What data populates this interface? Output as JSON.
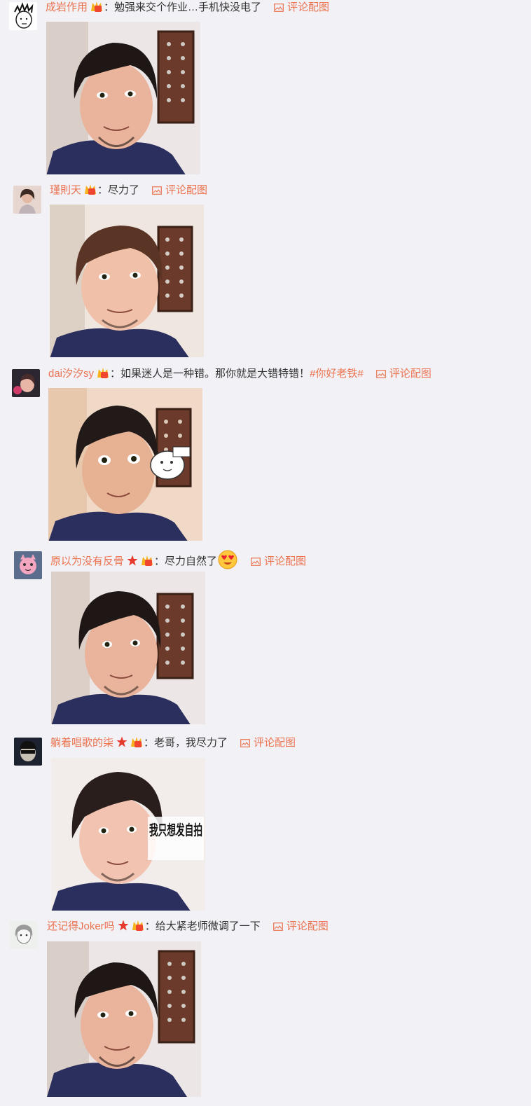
{
  "action_label": "评论配图",
  "comments": [
    {
      "user": "成岩作用",
      "sep": "：",
      "text": "勉强来交个作业…手机快没电了",
      "topic": "",
      "star": false,
      "emoji_face": false,
      "sticker_text": ""
    },
    {
      "user": "瑾則天",
      "sep": "：",
      "text": "尽力了",
      "topic": "",
      "star": false,
      "emoji_face": false,
      "sticker_text": ""
    },
    {
      "user": "dai汐汐sy",
      "sep": "：",
      "text": "如果迷人是一种错。那你就是大错特错！",
      "topic": "#你好老铁#",
      "star": false,
      "emoji_face": false,
      "sticker_text": "",
      "sticker": "cartoon-sticker"
    },
    {
      "user": "原以为没有反骨",
      "sep": "：",
      "text": "尽力自然了",
      "topic": "",
      "star": true,
      "emoji_face": true,
      "sticker_text": ""
    },
    {
      "user": "躺着唱歌的柒",
      "sep": "：",
      "text": "老哥，我尽力了",
      "topic": "",
      "star": true,
      "emoji_face": false,
      "sticker_text": "我只想发自拍"
    },
    {
      "user": "还记得Joker吗",
      "sep": "：",
      "text": "给大紧老师微调了一下",
      "topic": "",
      "star": true,
      "emoji_face": false,
      "sticker_text": ""
    }
  ],
  "colors": {
    "accent": "#eb7350",
    "background": "#f2f1f6",
    "text": "#333333"
  }
}
